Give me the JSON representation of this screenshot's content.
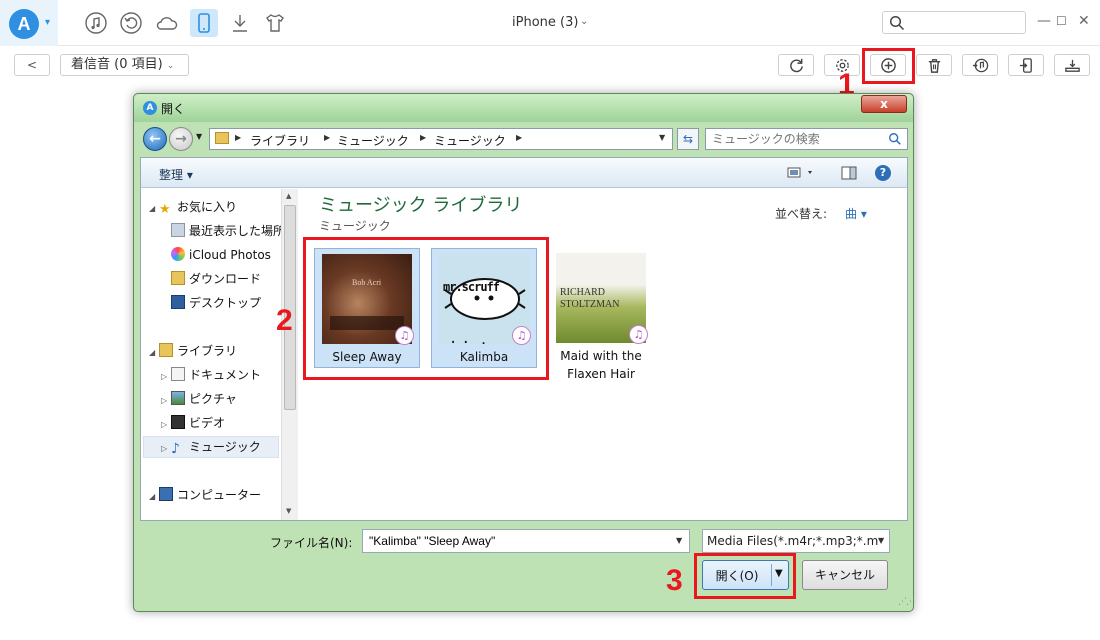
{
  "app": {
    "logo_letter": "A",
    "device_title": "iPhone (3)",
    "search_placeholder": ""
  },
  "toolbar_icons": [
    "music-icon",
    "restore-icon",
    "cloud-icon",
    "phone-icon",
    "download-icon",
    "shirt-icon"
  ],
  "subbar": {
    "back_label": "<",
    "category_label": "着信音 (0 項目)"
  },
  "actions": [
    "refresh-icon",
    "settings-icon",
    "add-icon",
    "delete-icon",
    "to-itunes-icon",
    "to-device-icon",
    "to-computer-icon"
  ],
  "steps": [
    "1",
    "2",
    "3"
  ],
  "dialog": {
    "title": "開く",
    "close_label": "x",
    "breadcrumbs": [
      "ライブラリ",
      "ミュージック",
      "ミュージック"
    ],
    "search_placeholder": "ミュージックの検索",
    "organize_label": "整理 ▾",
    "help_label": "?",
    "nav_items": [
      {
        "label": "お気に入り",
        "type": "header"
      },
      {
        "label": "最近表示した場所",
        "type": "item"
      },
      {
        "label": "iCloud Photos",
        "type": "item"
      },
      {
        "label": "ダウンロード",
        "type": "item"
      },
      {
        "label": "デスクトップ",
        "type": "item"
      },
      {
        "label": "ライブラリ",
        "type": "header"
      },
      {
        "label": "ドキュメント",
        "type": "sub"
      },
      {
        "label": "ピクチャ",
        "type": "sub"
      },
      {
        "label": "ビデオ",
        "type": "sub"
      },
      {
        "label": "ミュージック",
        "type": "sub",
        "selected": true
      },
      {
        "label": "コンピューター",
        "type": "header"
      }
    ],
    "library_title": "ミュージック ライブラリ",
    "library_subtitle": "ミュージック",
    "sort_label": "並べ替え:",
    "sort_value": "曲 ▾",
    "files": [
      {
        "label": "Sleep Away",
        "selected": true,
        "art_text": "Bob Acri"
      },
      {
        "label": "Kalimba",
        "selected": true,
        "art_text": "mr.scruff ninja tune"
      },
      {
        "label": "Maid with the Flaxen Hair",
        "selected": false,
        "art_text": "RICHARD STOLTZMAN"
      }
    ],
    "filename_label": "ファイル名(N):",
    "filename_value": "\"Kalimba\" \"Sleep Away\"",
    "filetype_value": "Media Files(*.m4r;*.mp3;*.m",
    "open_label": "開く(O)",
    "cancel_label": "キャンセル"
  },
  "colors": {
    "accent": "#2f8fe0",
    "highlight_red": "#e8181e",
    "dialog_frame": "#bfe2b5",
    "library_title": "#1e6a39"
  }
}
